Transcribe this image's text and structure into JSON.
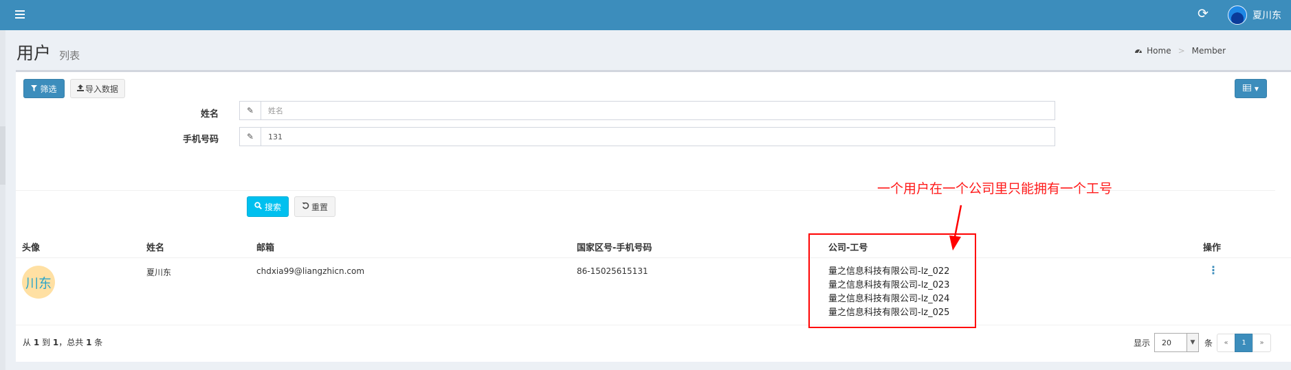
{
  "topbar": {
    "menu_icon": "hamburger-icon",
    "refresh_icon": "refresh-icon",
    "refresh_glyph": "⟳",
    "user_name": "夏川东"
  },
  "header": {
    "title": "用户",
    "subtitle": "列表"
  },
  "breadcrumb": {
    "icon": "dashboard-icon",
    "home": "Home",
    "current": "Member"
  },
  "toolbar": {
    "filter_label": "筛选",
    "import_label": "导入数据",
    "grid_icon": "grid-icon"
  },
  "filter": {
    "name_label": "姓名",
    "name_placeholder": "姓名",
    "name_value": "",
    "phone_label": "手机号码",
    "phone_value": "131",
    "search_label": "搜索",
    "reset_label": "重置"
  },
  "table": {
    "headers": [
      "头像",
      "姓名",
      "邮箱",
      "国家区号-手机号码",
      "公司-工号",
      "操作"
    ],
    "rows": [
      {
        "avatar_text": "川东",
        "name": "夏川东",
        "email": "chdxia99@liangzhicn.com",
        "phone": "86-15025615131",
        "companies": [
          "量之信息科技有限公司-lz_022",
          "量之信息科技有限公司-lz_023",
          "量之信息科技有限公司-lz_024",
          "量之信息科技有限公司-lz_025"
        ],
        "action_icon": "more-vertical-icon"
      }
    ]
  },
  "summary": {
    "prefix": "从",
    "from": "1",
    "to_word": "到",
    "to": "1",
    "total_word": "，总共",
    "total": "1",
    "unit": "条"
  },
  "pager": {
    "show_label": "显示",
    "per_page": "20",
    "unit_label": "条",
    "prev": "«",
    "current": "1",
    "next": "»"
  },
  "annotation": {
    "text": "一个用户在一个公司里只能拥有一个工号",
    "color": "#ff0000"
  },
  "colors": {
    "primary": "#3c8dbc",
    "info": "#00c0ef",
    "background": "#ecf0f5"
  }
}
